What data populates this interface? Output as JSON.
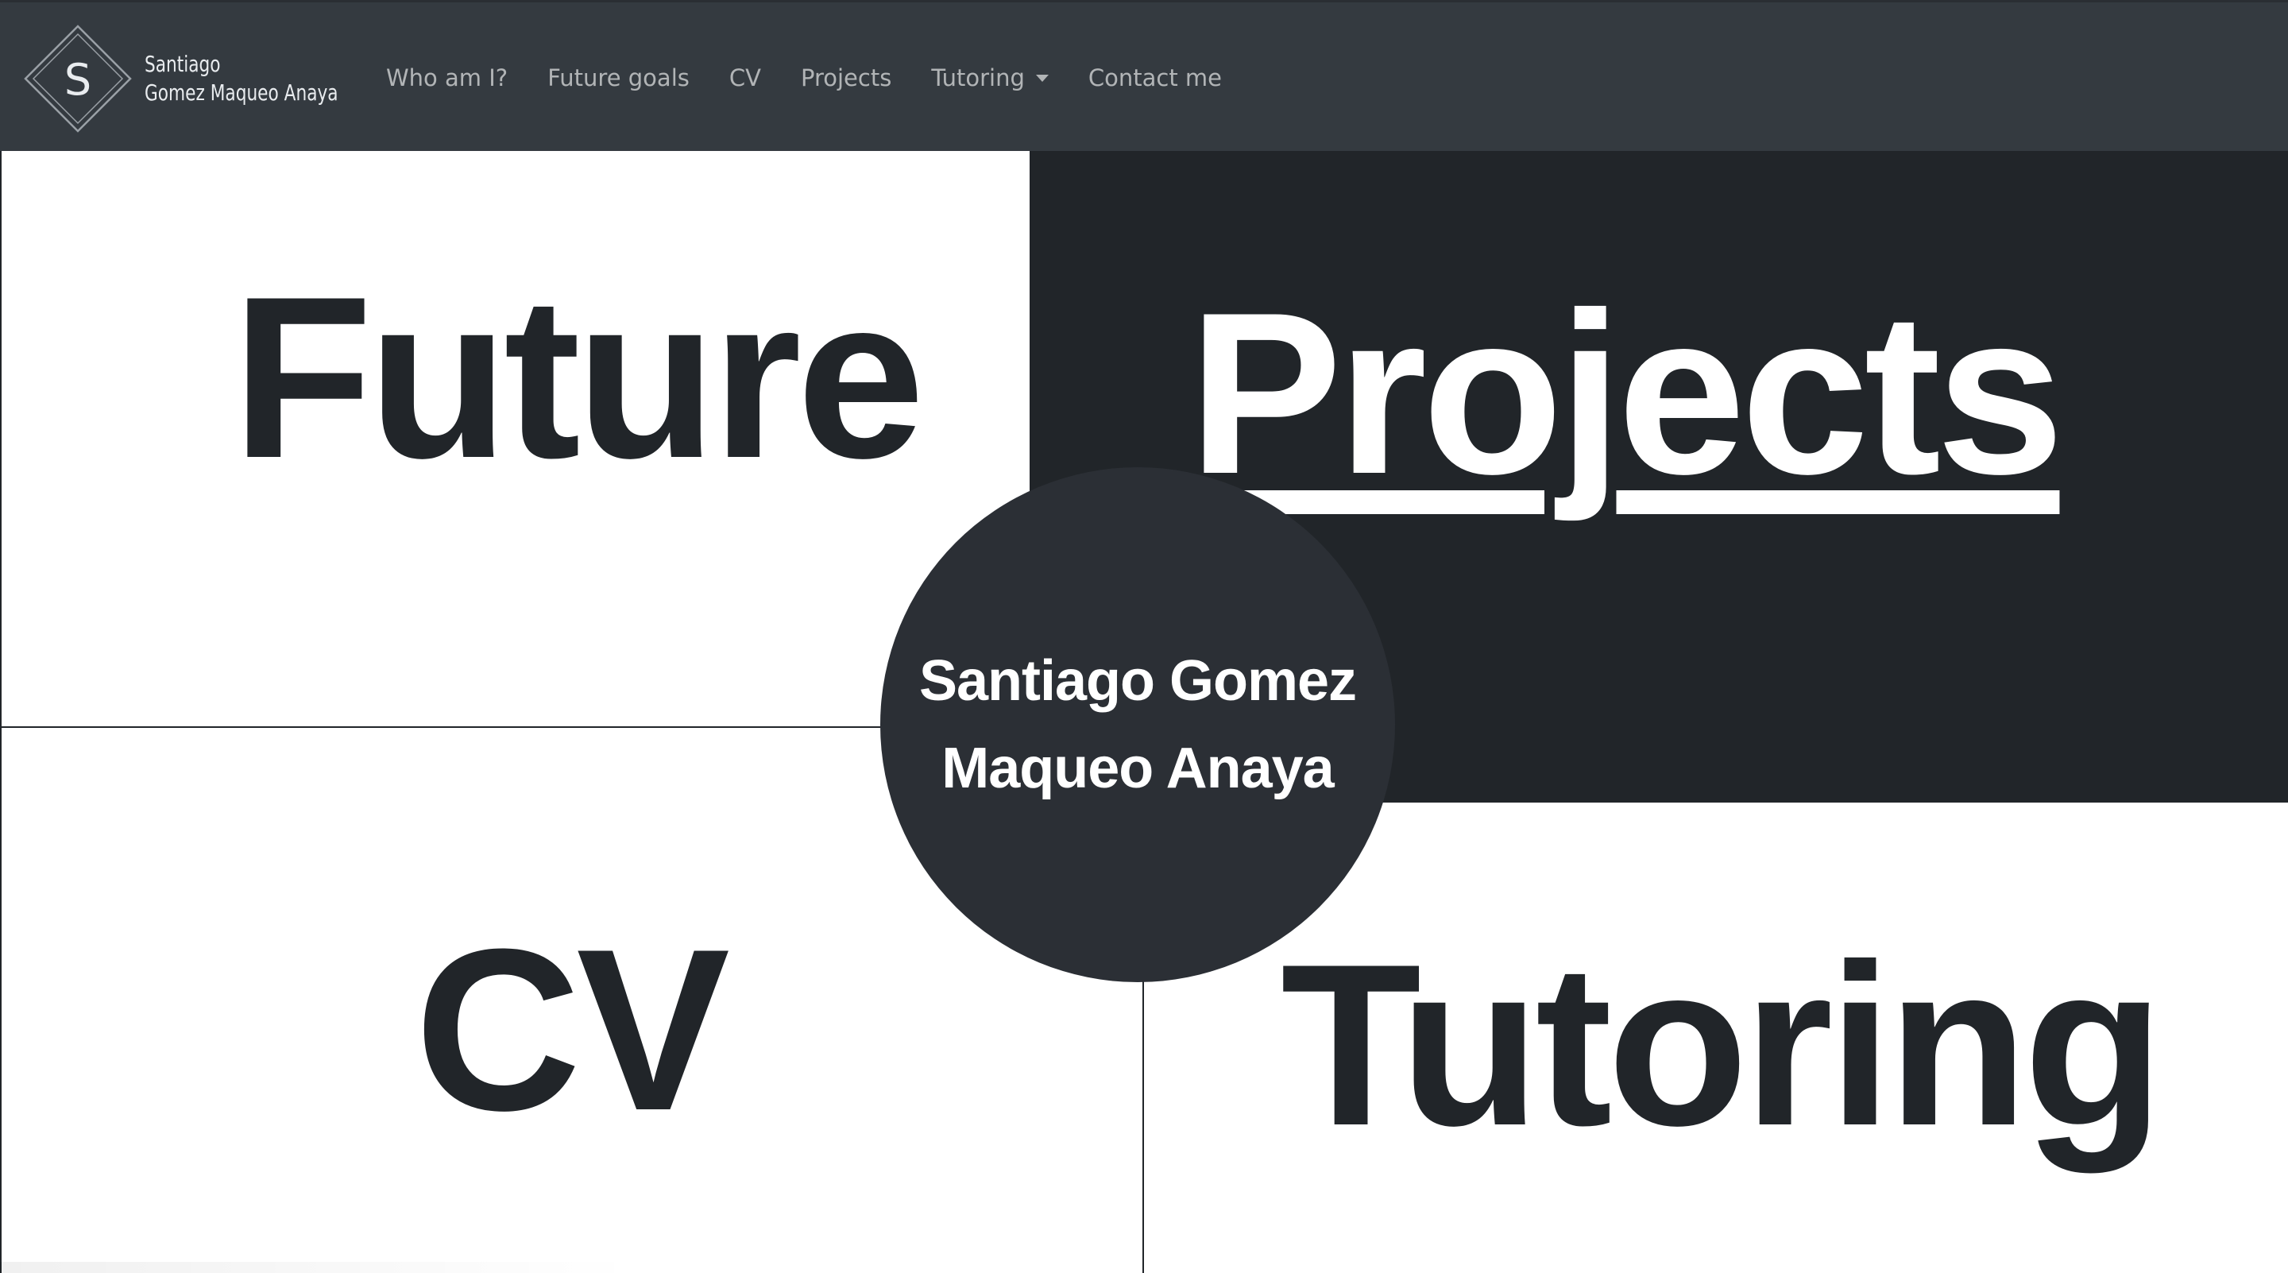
{
  "navbar": {
    "brand": {
      "logo_letter": "S",
      "line1": "Santiago",
      "line2": "Gomez Maqueo Anaya"
    },
    "links": [
      {
        "label": "Who am I?"
      },
      {
        "label": "Future goals"
      },
      {
        "label": "CV"
      },
      {
        "label": "Projects"
      },
      {
        "label": "Tutoring",
        "has_dropdown": true
      },
      {
        "label": "Contact me"
      }
    ]
  },
  "sections": {
    "future": {
      "label": "Future"
    },
    "projects": {
      "label": "Projects"
    },
    "cv": {
      "label": "CV"
    },
    "tutoring": {
      "label": "Tutoring"
    }
  },
  "center": {
    "line1": "Santiago Gomez",
    "line2": "Maqueo Anaya"
  },
  "colors": {
    "navbar_bg": "#343a40",
    "dark": "#212529",
    "circle": "#2b2f35",
    "light": "#ffffff"
  }
}
